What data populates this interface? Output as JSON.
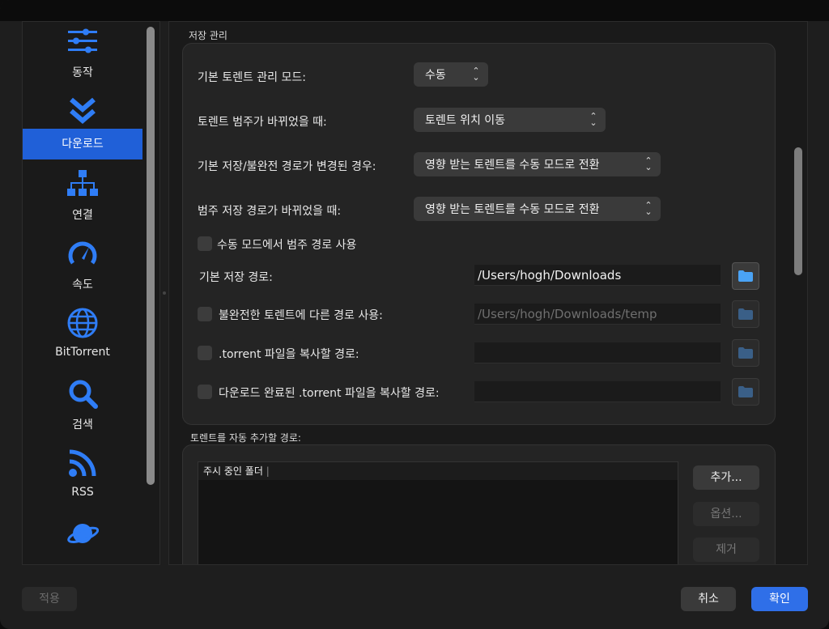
{
  "sidebar": {
    "items": [
      {
        "label": "동작",
        "icon": "sliders-icon"
      },
      {
        "label": "다운로드",
        "icon": "double-chevron-down-icon"
      },
      {
        "label": "연결",
        "icon": "network-icon"
      },
      {
        "label": "속도",
        "icon": "speedometer-icon"
      },
      {
        "label": "BitTorrent",
        "icon": "globe-icon"
      },
      {
        "label": "검색",
        "icon": "search-icon"
      },
      {
        "label": "RSS",
        "icon": "rss-icon"
      },
      {
        "label": "",
        "icon": "planet-icon"
      }
    ],
    "selected": "다운로드",
    "accent": "#2060d8",
    "icon_color": "#2f7df6"
  },
  "storage": {
    "title": "저장 관리",
    "default_mode_label": "기본 토렌트 관리 모드:",
    "default_mode_value": "수동",
    "category_changed_label": "토렌트 범주가 바뀌었을 때:",
    "category_changed_value": "토렌트 위치 이동",
    "default_path_changed_label": "기본 저장/불완전 경로가 변경된 경우:",
    "default_path_changed_value": "영향 받는 토렌트를 수동 모드로 전환",
    "category_path_changed_label": "범주 저장 경로가 바뀌었을 때:",
    "category_path_changed_value": "영향 받는 토렌트를 수동 모드로 전환",
    "use_category_paths_label": "수동 모드에서 범주 경로 사용",
    "default_save_path_label": "기본 저장 경로:",
    "default_save_path_value": "/Users/hogh/Downloads",
    "incomplete_path_label": "불완전한 토렌트에 다른 경로 사용:",
    "incomplete_path_value": "/Users/hogh/Downloads/temp",
    "copy_torrent_label": ".torrent 파일을 복사할 경로:",
    "copy_finished_label": "다운로드 완료된 .torrent 파일을 복사할 경로:"
  },
  "autoadd": {
    "title": "토렌트를 자동 추가할 경로:",
    "header": "주시 중인 폴더",
    "add_label": "추가...",
    "options_label": "옵션...",
    "remove_label": "제거"
  },
  "footer": {
    "apply_label": "적용",
    "cancel_label": "취소",
    "ok_label": "확인",
    "ok_color": "#2f6fe8"
  }
}
